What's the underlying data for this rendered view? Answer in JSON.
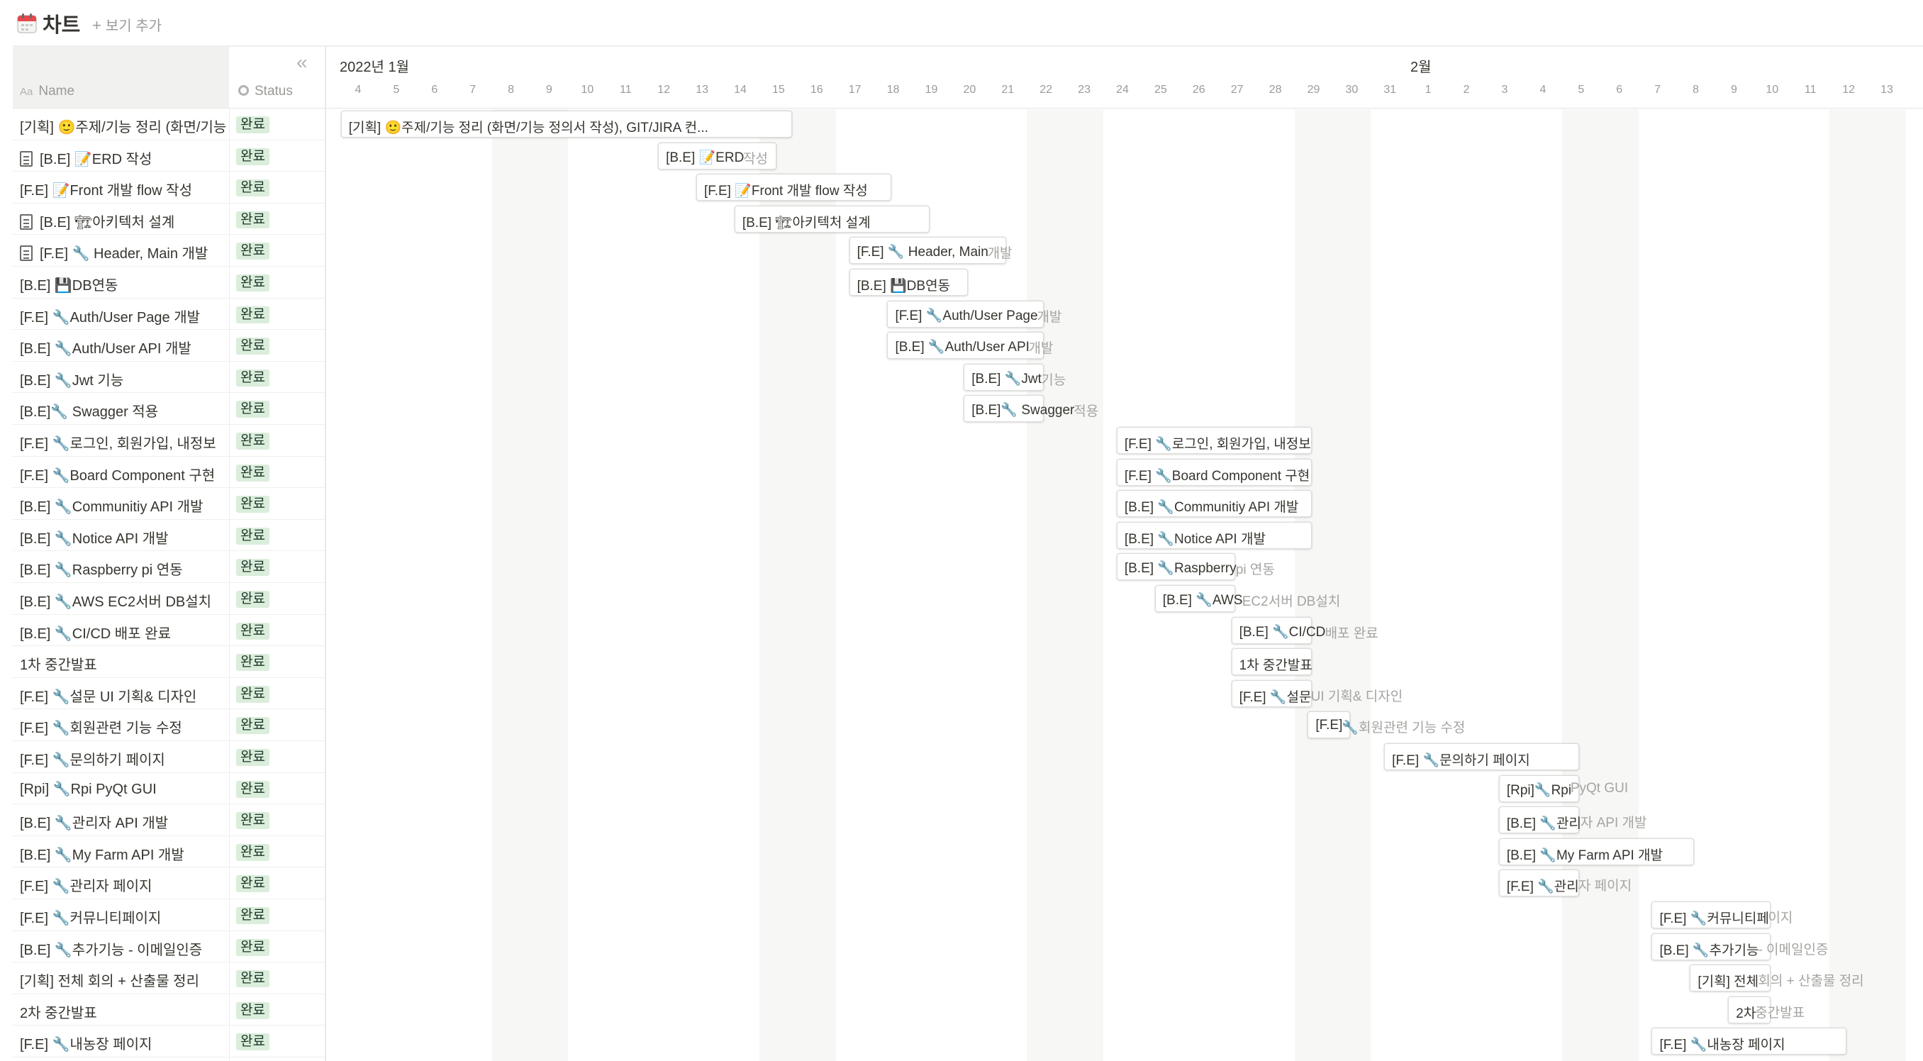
{
  "header": {
    "title": "차트",
    "add_view_label": "보기 추가",
    "add_view_plus": "+"
  },
  "table": {
    "collapse_icon": "«",
    "name_header": "Name",
    "name_header_icon": "Aa",
    "status_header": "Status"
  },
  "timeline": {
    "months": [
      {
        "label": "2022년 1월"
      },
      {
        "label": "2월"
      }
    ],
    "days": [
      "4",
      "5",
      "6",
      "7",
      "8",
      "9",
      "10",
      "11",
      "12",
      "13",
      "14",
      "15",
      "16",
      "17",
      "18",
      "19",
      "20",
      "21",
      "22",
      "23",
      "24",
      "25",
      "26",
      "27",
      "28",
      "29",
      "30",
      "31",
      "1",
      "2",
      "3",
      "4",
      "5",
      "6",
      "7",
      "8",
      "9",
      "10",
      "11",
      "12",
      "13"
    ]
  },
  "tasks": [
    {
      "name": "[기획] 🙂주제/기능 정리 (화면/기능 정의서 작성), GIT/JIRA 컨...",
      "status": "완료",
      "doc": false,
      "bar_text": "[기획] 🙂주제/기능 정리 (화면/기능 정의서 작성), GIT/JIRA 컨...",
      "bar_overflow": ""
    },
    {
      "name": "[B.E] 📝ERD 작성",
      "status": "완료",
      "doc": true,
      "bar_text": "[B.E] 📝ERD",
      "bar_overflow": " 작성"
    },
    {
      "name": "[F.E] 📝Front 개발 flow 작성",
      "status": "완료",
      "doc": false,
      "bar_text": "[F.E] 📝Front 개발 flow 작성",
      "bar_overflow": ""
    },
    {
      "name": "[B.E] 🏗아키텍처 설계",
      "status": "완료",
      "doc": true,
      "bar_text": "[B.E] 🏗아키텍처 설계",
      "bar_overflow": ""
    },
    {
      "name": "[F.E] 🔧 Header, Main 개발",
      "status": "완료",
      "doc": true,
      "bar_text": "[F.E] 🔧 Header, Main",
      "bar_overflow": " 개발"
    },
    {
      "name": "[B.E] 💾DB연동",
      "status": "완료",
      "doc": false,
      "bar_text": "[B.E] 💾DB연동",
      "bar_overflow": ""
    },
    {
      "name": "[F.E] 🔧Auth/User Page 개발",
      "status": "완료",
      "doc": false,
      "bar_text": "[F.E] 🔧Auth/User Page",
      "bar_overflow": " 개발"
    },
    {
      "name": "[B.E] 🔧Auth/User API 개발",
      "status": "완료",
      "doc": false,
      "bar_text": "[B.E] 🔧Auth/User API",
      "bar_overflow": " 개발"
    },
    {
      "name": "[B.E] 🔧Jwt 기능",
      "status": "완료",
      "doc": false,
      "bar_text": "[B.E] 🔧Jwt",
      "bar_overflow": " 기능"
    },
    {
      "name": "[B.E]🔧 Swagger 적용",
      "status": "완료",
      "doc": false,
      "bar_text": "[B.E]🔧 Swagger",
      "bar_overflow": " 적용"
    },
    {
      "name": "[F.E] 🔧로그인, 회원가입, 내정보",
      "status": "완료",
      "doc": false,
      "bar_text": "[F.E] 🔧로그인, 회원가입, 내정보",
      "bar_overflow": ""
    },
    {
      "name": "[F.E] 🔧Board Component 구현",
      "status": "완료",
      "doc": false,
      "bar_text": "[F.E] 🔧Board Component 구현",
      "bar_overflow": ""
    },
    {
      "name": "[B.E] 🔧Communitiy API 개발",
      "status": "완료",
      "doc": false,
      "bar_text": "[B.E] 🔧Communitiy API 개발",
      "bar_overflow": ""
    },
    {
      "name": "[B.E] 🔧Notice API 개발",
      "status": "완료",
      "doc": false,
      "bar_text": "[B.E] 🔧Notice API 개발",
      "bar_overflow": ""
    },
    {
      "name": "[B.E] 🔧Raspberry pi 연동",
      "status": "완료",
      "doc": false,
      "bar_text": "[B.E] 🔧Raspberry",
      "bar_overflow": " pi 연동"
    },
    {
      "name": "[B.E] 🔧AWS EC2서버 DB설치",
      "status": "완료",
      "doc": false,
      "bar_text": "[B.E] 🔧AWS",
      "bar_overflow": " EC2서버 DB설치"
    },
    {
      "name": "[B.E] 🔧CI/CD 배포 완료",
      "status": "완료",
      "doc": false,
      "bar_text": "[B.E] 🔧CI/CD",
      "bar_overflow": " 배포 완료"
    },
    {
      "name": "1차 중간발표",
      "status": "완료",
      "doc": false,
      "bar_text": "1차 중간발표",
      "bar_overflow": ""
    },
    {
      "name": "[F.E] 🔧설문 UI 기획& 디자인",
      "status": "완료",
      "doc": false,
      "bar_text": "[F.E] 🔧설문",
      "bar_overflow": " UI 기획& 디자인"
    },
    {
      "name": "[F.E] 🔧회원관련 기능 수정",
      "status": "완료",
      "doc": false,
      "bar_text": "[F.E]",
      "bar_overflow": " 🔧회원관련 기능 수정"
    },
    {
      "name": "[F.E] 🔧문의하기 페이지",
      "status": "완료",
      "doc": false,
      "bar_text": "[F.E] 🔧문의하기 페이지",
      "bar_overflow": ""
    },
    {
      "name": "[Rpi] 🔧Rpi PyQt GUI",
      "status": "완료",
      "doc": false,
      "bar_text": "[Rpi]🔧Rpi",
      "bar_overflow": " PyQt GUI"
    },
    {
      "name": "[B.E] 🔧관리자 API 개발",
      "status": "완료",
      "doc": false,
      "bar_text": "[B.E] 🔧관리",
      "bar_overflow": "자 API 개발"
    },
    {
      "name": "[B.E] 🔧My Farm API 개발",
      "status": "완료",
      "doc": false,
      "bar_text": "[B.E] 🔧My Farm API 개발",
      "bar_overflow": ""
    },
    {
      "name": "[F.E] 🔧관리자 페이지",
      "status": "완료",
      "doc": false,
      "bar_text": "[F.E] 🔧관리",
      "bar_overflow": "자 페이지"
    },
    {
      "name": "[F.E] 🔧커뮤니티페이지",
      "status": "완료",
      "doc": false,
      "bar_text": "[F.E] 🔧커뮤니티페",
      "bar_overflow": "이지"
    },
    {
      "name": "[B.E] 🔧추가기능 - 이메일인증",
      "status": "완료",
      "doc": false,
      "bar_text": "[B.E] 🔧추가기능",
      "bar_overflow": " - 이메일인증"
    },
    {
      "name": "[기획] 전체 회의 + 산출물 정리",
      "status": "완료",
      "doc": false,
      "bar_text": "[기획] 전체",
      "bar_overflow": " 회의 + 산출물 정리"
    },
    {
      "name": "2차 중간발표",
      "status": "완료",
      "doc": false,
      "bar_text": "2차",
      "bar_overflow": " 중간발표"
    },
    {
      "name": "[F.E] 🔧내농장 페이지",
      "status": "완료",
      "doc": false,
      "bar_text": "[F.E] 🔧내농장 페이지",
      "bar_overflow": ""
    }
  ]
}
